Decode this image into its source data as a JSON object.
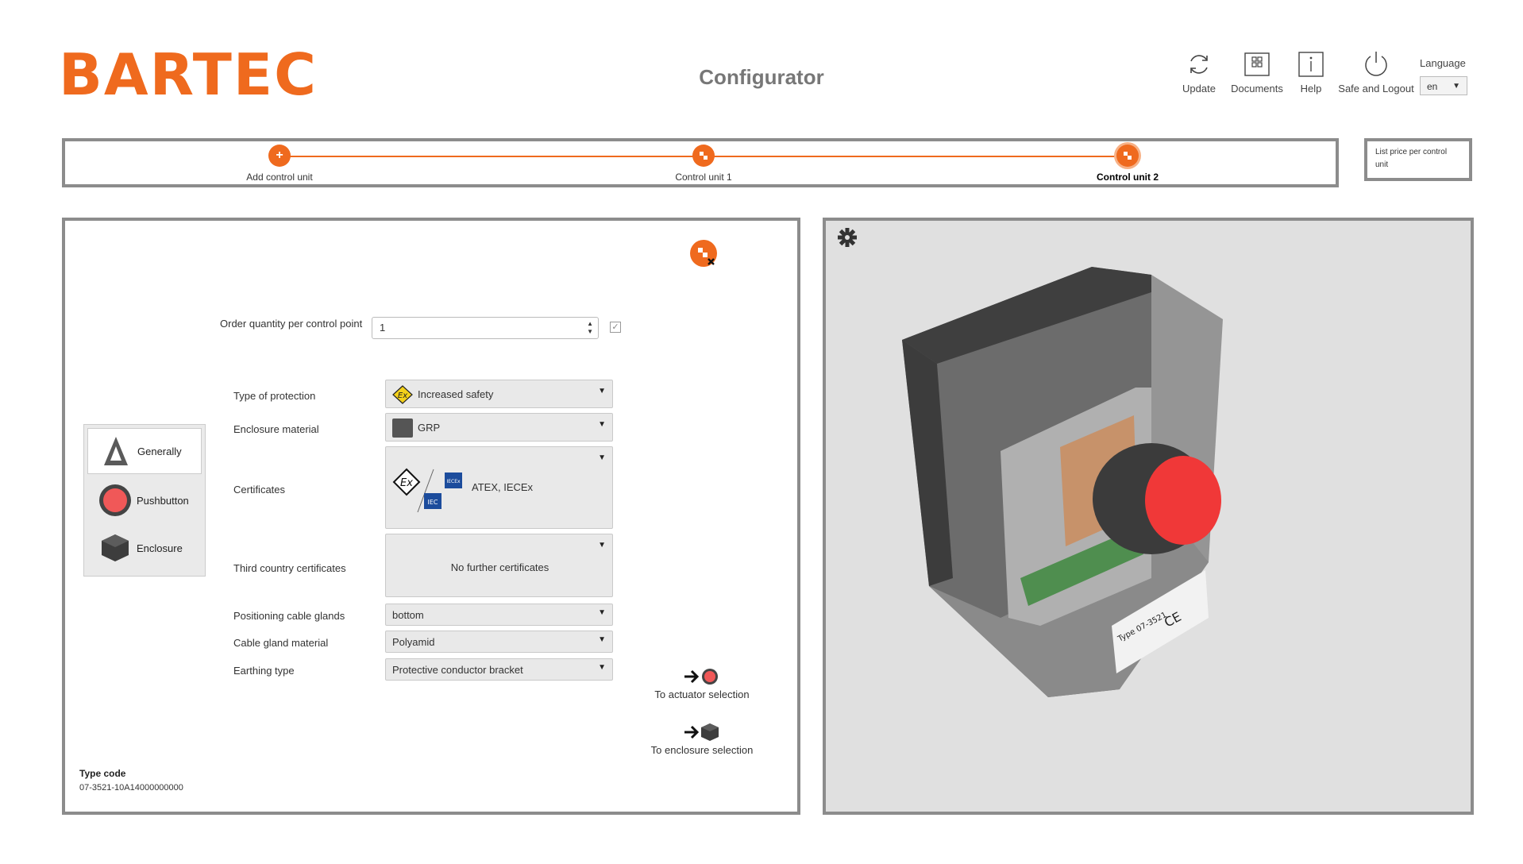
{
  "header": {
    "logo": "BARTEC",
    "title": "Configurator",
    "buttons": [
      {
        "label": "Update",
        "icon": "refresh-icon"
      },
      {
        "label": "Documents",
        "icon": "documents-icon"
      },
      {
        "label": "Help",
        "icon": "info-icon"
      },
      {
        "label": "Safe and Logout",
        "icon": "power-icon"
      }
    ],
    "language_label": "Language",
    "language_value": "en"
  },
  "progress": {
    "steps": [
      {
        "label": "Add control unit",
        "icon": "plus-icon",
        "active": false
      },
      {
        "label": "Control unit 1",
        "icon": "control-unit-icon",
        "active": false
      },
      {
        "label": "Control unit 2",
        "icon": "control-unit-icon",
        "active": true
      }
    ],
    "price_label": "List price per control unit"
  },
  "side_menu": [
    {
      "label": "Generally",
      "icon": "generally-icon",
      "selected": true
    },
    {
      "label": "Pushbutton",
      "icon": "pushbutton-icon",
      "selected": false
    },
    {
      "label": "Enclosure",
      "icon": "enclosure-icon",
      "selected": false
    }
  ],
  "form": {
    "quantity_label": "Order quantity per control point",
    "quantity_value": "1",
    "protection_label": "Type of protection",
    "protection_value": "Increased safety",
    "enclosure_material_label": "Enclosure material",
    "enclosure_material_value": "GRP",
    "certificates_label": "Certificates",
    "certificates_value": "ATEX, IECEx",
    "third_country_label": "Third country certificates",
    "third_country_value": "No further certificates",
    "cable_glands_label": "Positioning cable glands",
    "cable_glands_value": "bottom",
    "gland_material_label": "Cable gland material",
    "gland_material_value": "Polyamid",
    "earthing_label": "Earthing type",
    "earthing_value": "Protective conductor bracket"
  },
  "nav_links": {
    "actuator": "To actuator selection",
    "enclosure": "To enclosure selection"
  },
  "type_code": {
    "label": "Type code",
    "value": "07-3521-10A14000000000"
  },
  "viewer": {
    "label_lines": [
      "Type 07-3521",
      "CE"
    ]
  },
  "colors": {
    "brand_orange": "#ef6a1e",
    "frame_gray": "#8c8c8c",
    "button_red": "#ff3b3b"
  }
}
